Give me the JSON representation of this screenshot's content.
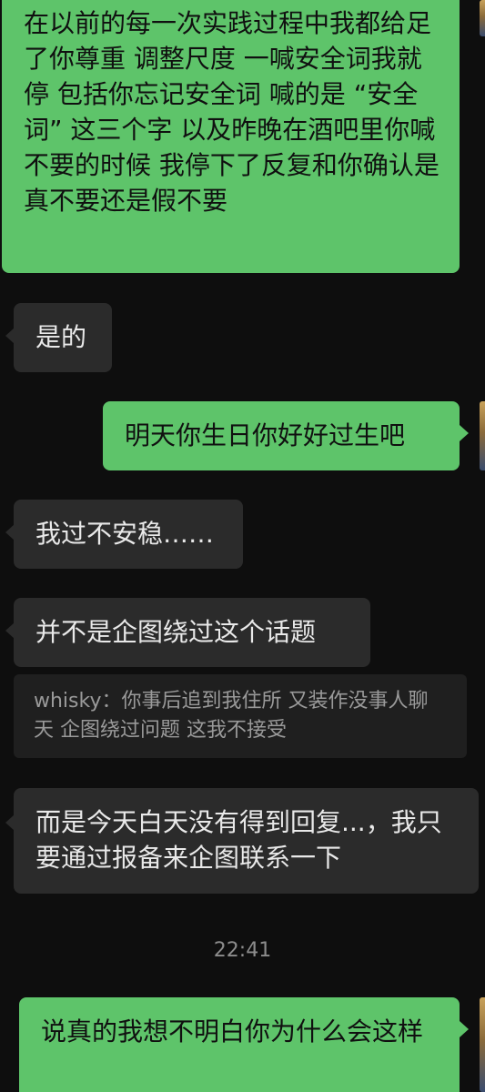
{
  "messages": [
    {
      "id": "m1",
      "side": "out",
      "text": "在以前的每一次实践过程中我都给足了你尊重 调整尺度 一喊安全词我就停 包括你忘记安全词 喊的是 “安全词” 这三个字 以及昨晚在酒吧里你喊不要的时候 我停下了反复和你确认是真不要还是假不要"
    },
    {
      "id": "m2",
      "side": "in",
      "text": "是的"
    },
    {
      "id": "m3",
      "side": "out",
      "text": "明天你生日你好好过生吧"
    },
    {
      "id": "m4",
      "side": "in",
      "text": "我过不安稳……"
    },
    {
      "id": "m5",
      "side": "in",
      "text": "并不是企图绕过这个话题"
    },
    {
      "id": "m6",
      "side": "in",
      "text": "而是今天白天没有得到回复...，我只要通过报备来企图联系一下"
    },
    {
      "id": "m7",
      "side": "out",
      "text": "说真的我想不明白你为什么会这样"
    }
  ],
  "quote": {
    "text": "whisky：你事后追到我住所 又装作没事人聊天 企图绕过问题 这我不接受"
  },
  "timestamp": "22:41",
  "colors": {
    "background": "#0e0e0e",
    "outgoing_bubble": "#5ec46a",
    "incoming_bubble": "#2b2b2b",
    "quote_bubble": "#1f1f1f",
    "timestamp_text": "#8c8c8c"
  }
}
